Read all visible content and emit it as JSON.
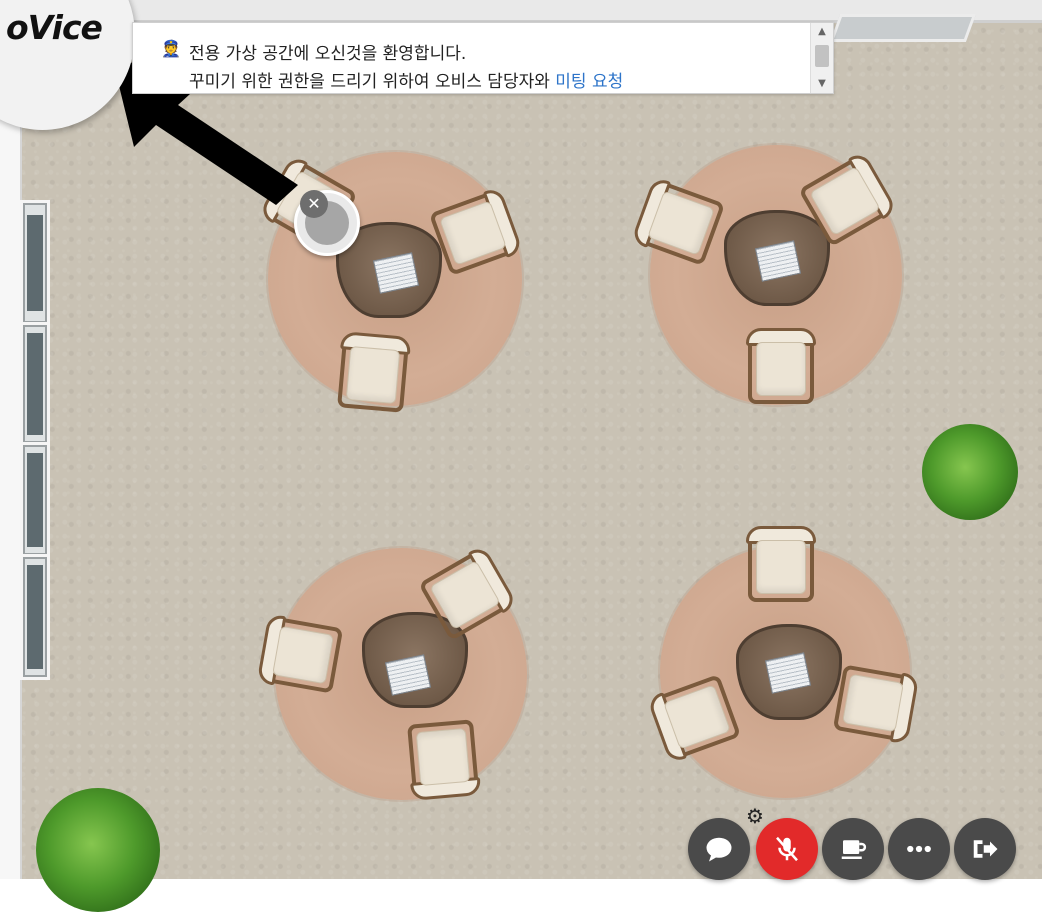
{
  "app": {
    "logo_text": "oVice"
  },
  "notice": {
    "line1": "전용 가상 공간에 오신것을 환영합니다.",
    "line2_prefix": "꾸미기 위한 권한을 드리기 위하여 오비스 담당자와 ",
    "line2_link": "미팅 요청",
    "icon": "user-badge-icon"
  },
  "controls": [
    {
      "name": "chat-button",
      "icon": "chat-bubble-icon"
    },
    {
      "name": "mic-button",
      "icon": "mic-off-icon",
      "state": "muted"
    },
    {
      "name": "break-button",
      "icon": "coffee-cup-icon"
    },
    {
      "name": "more-button",
      "icon": "more-dots-icon"
    },
    {
      "name": "exit-button",
      "icon": "exit-door-icon"
    }
  ],
  "colors": {
    "mic_muted": "#e22a2a",
    "control_bg": "#4a4a4a",
    "link": "#2d74c9"
  }
}
